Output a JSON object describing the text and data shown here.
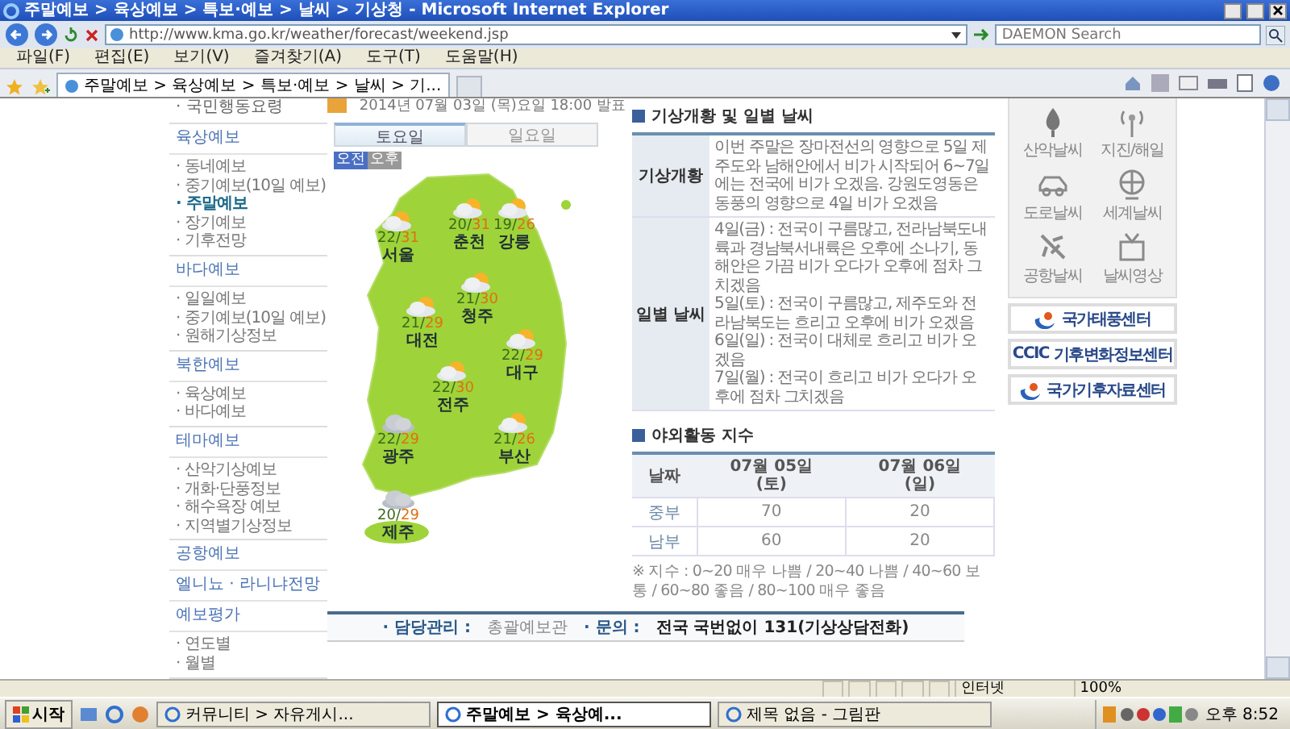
{
  "window": {
    "title": "주말예보 > 육상예보 > 특보·예보 > 날씨 > 기상청 - Microsoft Internet Explorer"
  },
  "address_bar": {
    "url": "http://www.kma.go.kr/weather/forecast/weekend.jsp"
  },
  "search": {
    "placeholder": "DAEMON Search"
  },
  "menu": [
    "파일(F)",
    "편집(E)",
    "보기(V)",
    "즐겨찾기(A)",
    "도구(T)",
    "도움말(H)"
  ],
  "browser_tab": {
    "label": "주말예보 > 육상예보 > 특보·예보 > 날씨 > 기..."
  },
  "sidebar": {
    "top_item": "· 국민행동요령",
    "sections": [
      {
        "title": "육상예보",
        "items": [
          {
            "label": "· 동네예보",
            "selected": false
          },
          {
            "label": "· 중기예보(10일 예보)",
            "selected": false
          },
          {
            "label": "· 주말예보",
            "selected": true
          },
          {
            "label": "· 장기예보",
            "selected": false
          },
          {
            "label": "· 기후전망",
            "selected": false
          }
        ]
      },
      {
        "title": "바다예보",
        "items": [
          {
            "label": "· 일일예보",
            "selected": false
          },
          {
            "label": "· 중기예보(10일 예보)",
            "selected": false
          },
          {
            "label": "· 원해기상정보",
            "selected": false
          }
        ]
      },
      {
        "title": "북한예보",
        "items": [
          {
            "label": "· 육상예보",
            "selected": false
          },
          {
            "label": "· 바다예보",
            "selected": false
          }
        ]
      },
      {
        "title": "테마예보",
        "items": [
          {
            "label": "· 산악기상예보",
            "selected": false
          },
          {
            "label": "· 개화·단풍정보",
            "selected": false
          },
          {
            "label": "· 해수욕장 예보",
            "selected": false
          },
          {
            "label": "· 지역별기상정보",
            "selected": false
          }
        ]
      },
      {
        "title": "공항예보"
      },
      {
        "title": "엘니뇨 · 라니냐전망"
      },
      {
        "title": "예보평가",
        "items": [
          {
            "label": "· 연도별",
            "selected": false
          },
          {
            "label": "· 월별",
            "selected": false
          }
        ]
      }
    ]
  },
  "issue": {
    "text": "2014년 07월 03일 (목)요일 18:00 발표"
  },
  "day_tabs": [
    {
      "label": "토요일",
      "selected": true
    },
    {
      "label": "일요일",
      "selected": false
    }
  ],
  "time_toggle": [
    {
      "label": "오전",
      "selected": true
    },
    {
      "label": "오후",
      "selected": false
    }
  ],
  "cities": [
    {
      "name": "서울",
      "low": "22/",
      "high": "31",
      "kind": "partly_cloudy"
    },
    {
      "name": "춘천",
      "low": "20/",
      "high": "31",
      "kind": "partly_cloudy"
    },
    {
      "name": "강릉",
      "low": "19/",
      "high": "26",
      "kind": "partly_cloudy"
    },
    {
      "name": "청주",
      "low": "21/",
      "high": "30",
      "kind": "partly_cloudy"
    },
    {
      "name": "대전",
      "low": "21/",
      "high": "29",
      "kind": "partly_cloudy"
    },
    {
      "name": "대구",
      "low": "22/",
      "high": "29",
      "kind": "partly_cloudy"
    },
    {
      "name": "전주",
      "low": "22/",
      "high": "30",
      "kind": "partly_cloudy"
    },
    {
      "name": "광주",
      "low": "22/",
      "high": "29",
      "kind": "cloudy"
    },
    {
      "name": "부산",
      "low": "21/",
      "high": "26",
      "kind": "partly_cloudy"
    },
    {
      "name": "제주",
      "low": "20/",
      "high": "29",
      "kind": "cloudy"
    }
  ],
  "weather_summary": {
    "title": "기상개황 및 일별 날씨",
    "rows": [
      {
        "label": "기상개황",
        "lines": [
          "이번 주말은 장마전선의 영향으로 5일 제주도와 남해안에서 비가 시작되어 6~7일에는 전국에 비가 오겠음. 강원도영동은 동풍의 영향으로 4일 비가 오겠음"
        ]
      },
      {
        "label": "일별 날씨",
        "lines": [
          "4일(금) : 전국이 구름많고, 전라남북도내륙과 경남북서내륙은 오후에 소나기, 동해안은 가끔 비가 오다가 오후에 점차 그치겠음",
          "5일(토) : 전국이 구름많고, 제주도와 전라남북도는 흐리고 오후에 비가 오겠음",
          "6일(일) : 전국이 대체로 흐리고 비가 오겠음",
          "7일(월) : 전국이 흐리고 비가 오다가 오후에 점차 그치겠음"
        ]
      }
    ]
  },
  "outdoor_index": {
    "title": "야외활동 지수",
    "columns": [
      {
        "date": "날짜"
      },
      {
        "date": "07월 05일",
        "day": "(토)"
      },
      {
        "date": "07월 06일",
        "day": "(일)"
      }
    ],
    "rows": [
      [
        "중부",
        "70",
        "20"
      ],
      [
        "남부",
        "60",
        "20"
      ]
    ],
    "note": "※ 지수 : 0~20 매우 나쁨 / 20~40 나쁨 / 40~60 보통 / 60~80 좋음 / 80~100 매우 좋음"
  },
  "footer": [
    {
      "label": "· 담당관리 :",
      "value": "총괄예보관"
    },
    {
      "label": "· 문의 :",
      "value": "전국 국번없이 131(기상상담전화)"
    }
  ],
  "quick_links": [
    {
      "label": "산악날씨",
      "kind": "tree"
    },
    {
      "label": "지진/해일",
      "kind": "antenna"
    },
    {
      "label": "도로날씨",
      "kind": "car"
    },
    {
      "label": "세계날씨",
      "kind": "globe"
    },
    {
      "label": "공항날씨",
      "kind": "plane"
    },
    {
      "label": "날씨영상",
      "kind": "tv"
    }
  ],
  "banners": [
    {
      "label": "국가태풍센터",
      "kind": "swirl"
    },
    {
      "label": "기후변화정보센터",
      "kind": "ccic",
      "logo": "CCIC"
    },
    {
      "label": "국가기후자료센터",
      "kind": "swirl"
    }
  ],
  "status_bar": {
    "zone": "인터넷",
    "zoom": "100%"
  },
  "taskbar": {
    "start": "시작",
    "windows": [
      {
        "label": "커뮤니티 > 자유게시...",
        "selected": false
      },
      {
        "label": "주말예보 > 육상예...",
        "selected": true
      },
      {
        "label": "제목 없음 - 그림판",
        "selected": false
      }
    ],
    "clock": "오후 8:52"
  }
}
